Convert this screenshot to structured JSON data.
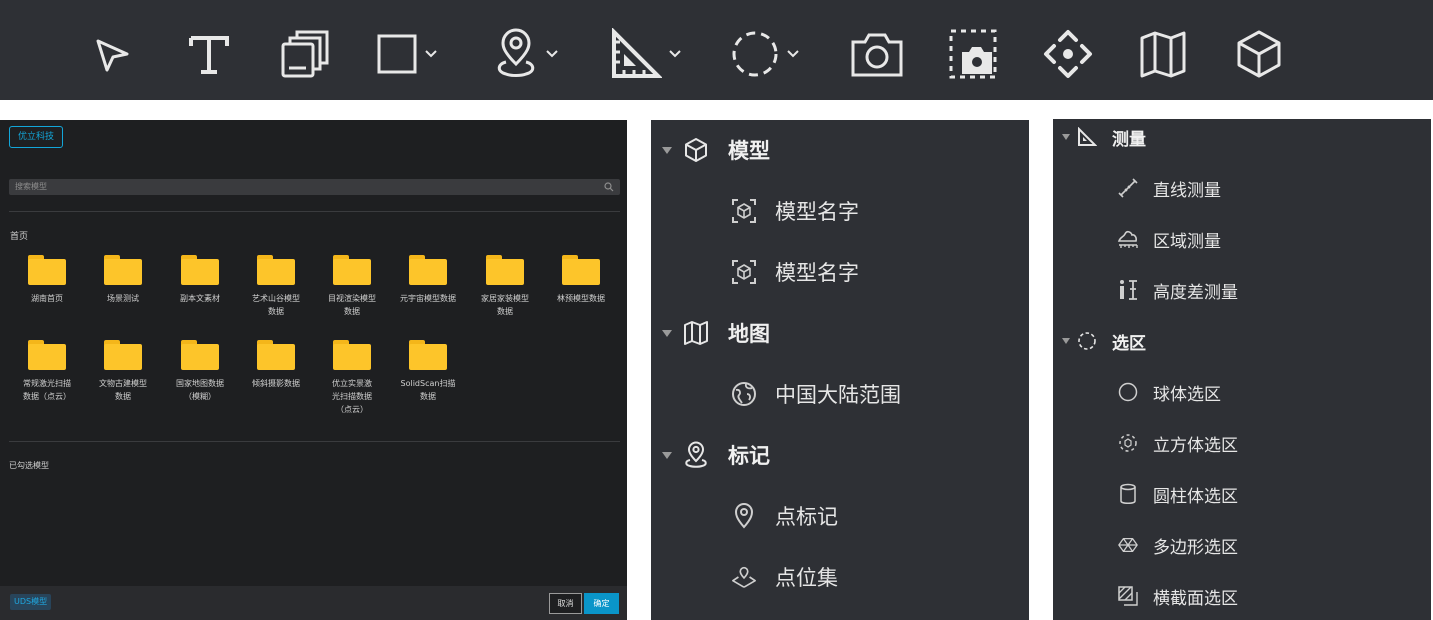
{
  "colors": {
    "toolbar_bg": "#2e3035",
    "dialog_bg": "#1e1f21",
    "panel_bg": "#2e3035",
    "accent": "#13a6d9",
    "folder": "#fdc52a",
    "primary_button": "#0a95c9"
  },
  "toolbar": {
    "tools": [
      {
        "icon": "cursor-arrow-icon"
      },
      {
        "icon": "text-tool-icon"
      },
      {
        "icon": "layers-stack-icon"
      },
      {
        "icon": "rectangle-icon",
        "dropdown": true
      },
      {
        "icon": "location-pin-icon",
        "dropdown": true
      },
      {
        "icon": "ruler-triangle-icon",
        "dropdown": true
      },
      {
        "icon": "dashed-circle-selection-icon",
        "dropdown": true
      },
      {
        "icon": "camera-icon"
      },
      {
        "icon": "region-screenshot-icon"
      },
      {
        "icon": "move-arrows-icon"
      },
      {
        "icon": "folded-map-icon"
      },
      {
        "icon": "cube-icon"
      }
    ]
  },
  "dialog": {
    "brand_button": "优立科技",
    "search": {
      "placeholder": "搜索模型"
    },
    "home_label": "首页",
    "folders": [
      "湖南首页",
      "场景测试",
      "副本文素材",
      "艺术山谷模型\n数据",
      "目视渲染模型\n数据",
      "元宇宙模型数据",
      "家居家装模型\n数据",
      "林预模型数据",
      "常规激光扫描\n数据（点云）",
      "文物古建模型\n数据",
      "国家地图数据\n（模糊）",
      "倾斜摄影数据",
      "优立实景激\n光扫描数据\n（点云）",
      "SolidScan扫描\n数据"
    ],
    "selected_label": "已勾选模型",
    "footer_tag": "UDS模型",
    "cancel_label": "取消",
    "ok_label": "确定"
  },
  "layer_panel": {
    "model_group": {
      "label": "模型",
      "items": [
        "模型名字",
        "模型名字"
      ]
    },
    "map_group": {
      "label": "地图",
      "items": [
        "中国大陆范围"
      ]
    },
    "marker_group": {
      "label": "标记",
      "items": [
        "点标记",
        "点位集"
      ]
    }
  },
  "tool_panel": {
    "measure_group": {
      "label": "测量",
      "items": [
        "直线测量",
        "区域测量",
        "高度差测量"
      ]
    },
    "selection_group": {
      "label": "选区",
      "items": [
        "球体选区",
        "立方体选区",
        "圆柱体选区",
        "多边形选区",
        "横截面选区"
      ]
    }
  }
}
